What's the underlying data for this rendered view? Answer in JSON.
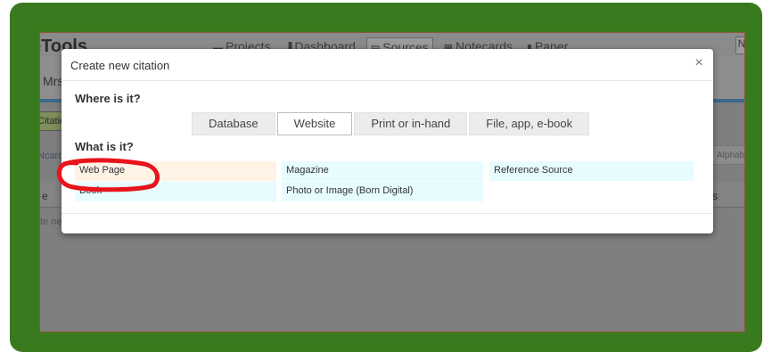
{
  "app": {
    "logo_text": "eTools",
    "nav_tabs": [
      {
        "label": "Projects",
        "icon": "folder-icon",
        "glyph": "▬"
      },
      {
        "label": "Dashboard",
        "icon": "bar-chart-icon",
        "glyph": "▐"
      },
      {
        "label": "Sources",
        "icon": "list-icon",
        "glyph": "▤"
      },
      {
        "label": "Notecards",
        "icon": "grid-icon",
        "glyph": "▦"
      },
      {
        "label": "Paper",
        "icon": "document-icon",
        "glyph": "▮"
      }
    ],
    "active_tab": "Sources",
    "user_button": "N",
    "user_label": "Mrs",
    "cite_button_label": "Citatio",
    "left_tab_label": "Ncard",
    "sort_label": "Alphab",
    "row_col_left": "e",
    "row_col_right": "s",
    "new_row_hint": "te ne"
  },
  "modal": {
    "title": "Create new citation",
    "close_glyph": "×",
    "where_question": "Where is it?",
    "where_options": [
      {
        "label": "Database",
        "active": false
      },
      {
        "label": "Website",
        "active": true
      },
      {
        "label": "Print or in-hand",
        "active": false
      },
      {
        "label": "File, app, e-book",
        "active": false
      }
    ],
    "what_question": "What is it?",
    "types": [
      {
        "label": "Web Page",
        "selected": true
      },
      {
        "label": "Magazine",
        "selected": false
      },
      {
        "label": "Reference Source",
        "selected": false
      },
      {
        "label": "Book",
        "selected": false
      },
      {
        "label": "Photo or Image (Born Digital)",
        "selected": false
      }
    ]
  },
  "colors": {
    "frame_green": "#3a7a1e",
    "annotation_red": "#e8141c",
    "type_bg": "#e6fcff",
    "type_selected_bg": "#fff3e6"
  }
}
